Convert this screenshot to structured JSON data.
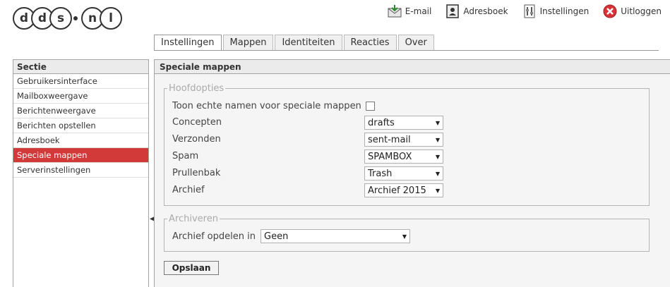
{
  "logo": {
    "letters": [
      "d",
      "d",
      "s",
      "n",
      "l"
    ]
  },
  "toplinks": [
    {
      "label": "E-mail",
      "icon": "mail-icon"
    },
    {
      "label": "Adresboek",
      "icon": "addressbook-icon"
    },
    {
      "label": "Instellingen",
      "icon": "settings-icon"
    },
    {
      "label": "Uitloggen",
      "icon": "logout-icon"
    }
  ],
  "tabs": [
    {
      "label": "Instellingen",
      "active": true
    },
    {
      "label": "Mappen"
    },
    {
      "label": "Identiteiten"
    },
    {
      "label": "Reacties"
    },
    {
      "label": "Over"
    }
  ],
  "sidebar": {
    "header": "Sectie",
    "items": [
      {
        "label": "Gebruikersinterface"
      },
      {
        "label": "Mailboxweergave"
      },
      {
        "label": "Berichtenweergave"
      },
      {
        "label": "Berichten opstellen"
      },
      {
        "label": "Adresboek"
      },
      {
        "label": "Speciale mappen",
        "active": true
      },
      {
        "label": "Serverinstellingen"
      }
    ]
  },
  "main": {
    "title": "Speciale mappen",
    "hoofdopties": {
      "legend": "Hoofdopties",
      "show_real_names_label": "Toon echte namen voor speciale mappen",
      "fields": [
        {
          "label": "Concepten",
          "value": "drafts"
        },
        {
          "label": "Verzonden",
          "value": "sent-mail"
        },
        {
          "label": "Spam",
          "value": "SPAMBOX"
        },
        {
          "label": "Prullenbak",
          "value": "Trash"
        },
        {
          "label": "Archief",
          "value": "Archief 2015"
        }
      ]
    },
    "archiveren": {
      "legend": "Archiveren",
      "label": "Archief opdelen in",
      "value": "Geen"
    },
    "save_label": "Opslaan"
  },
  "colors": {
    "accent": "#d23a3a",
    "panel_bg": "#f5f5f5",
    "header_bg": "#ebebeb"
  }
}
